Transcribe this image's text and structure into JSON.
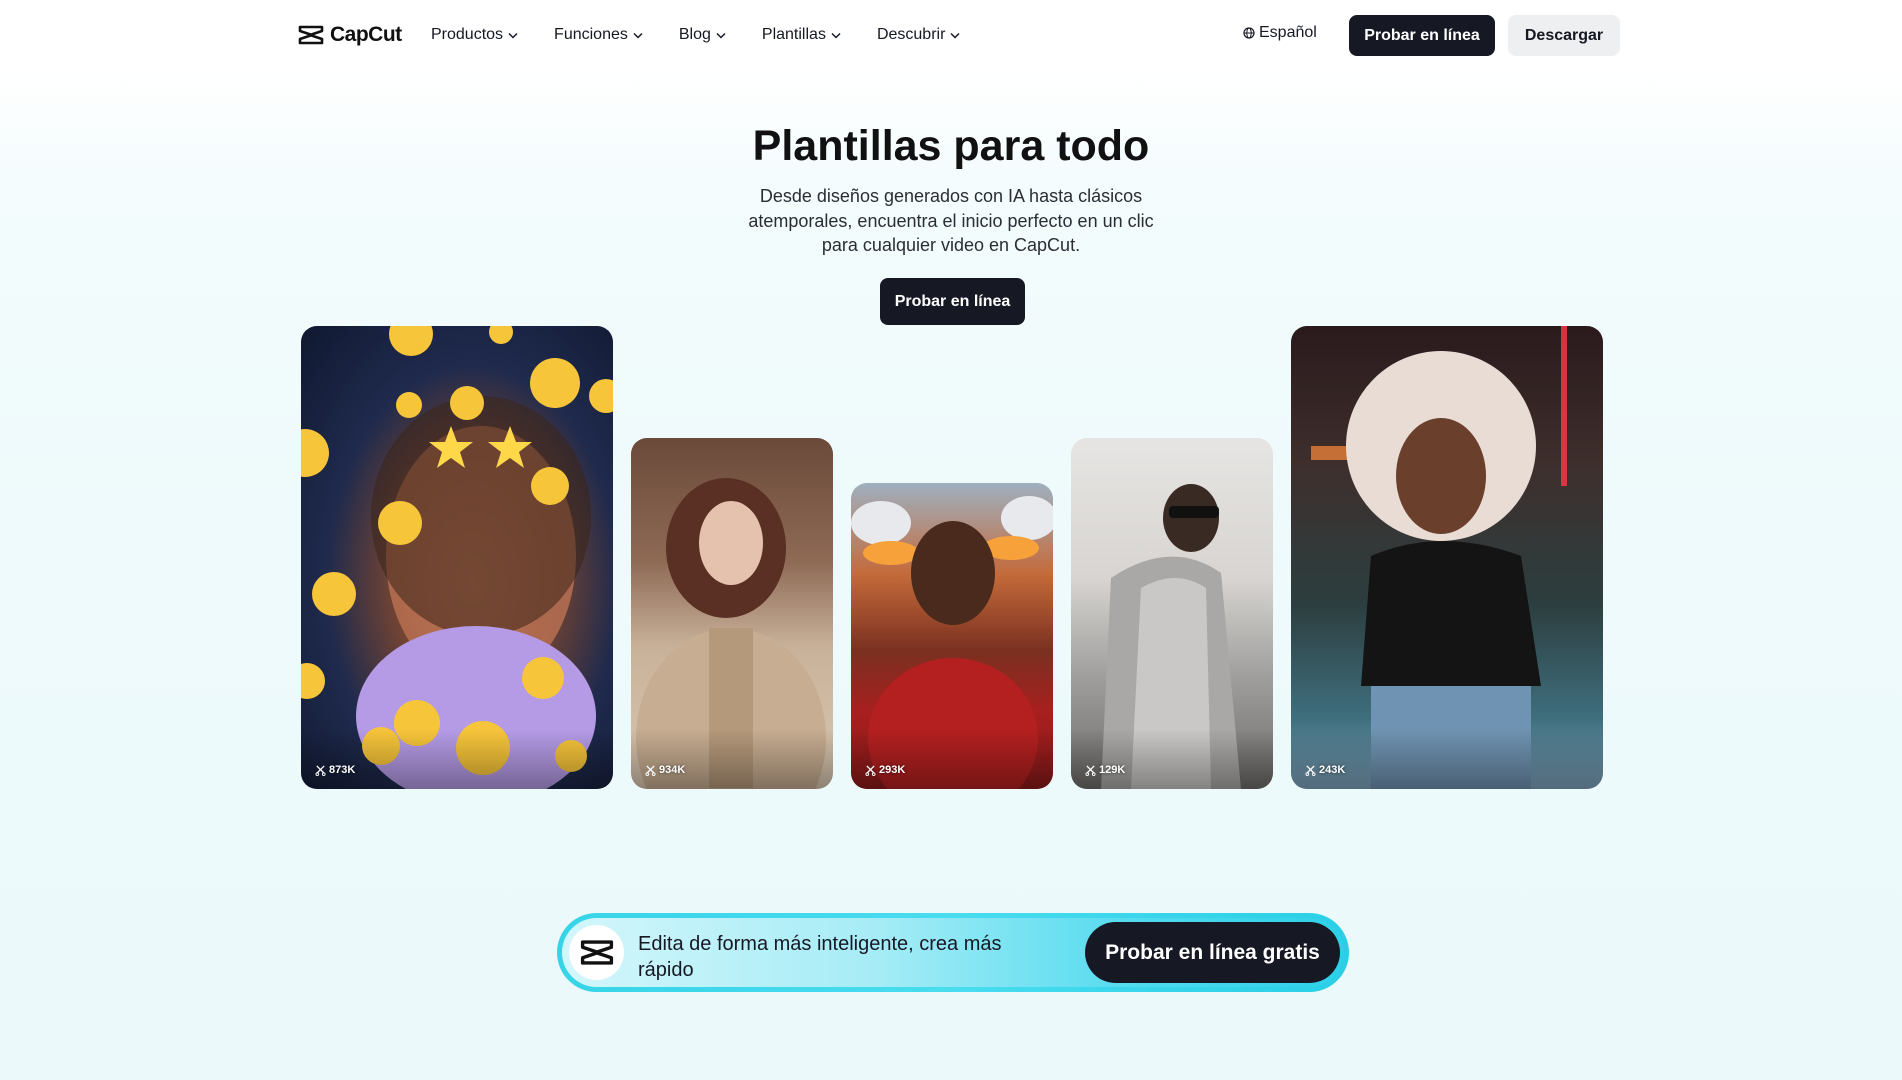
{
  "nav": {
    "brand": "CapCut",
    "items": [
      {
        "label": "Productos"
      },
      {
        "label": "Funciones"
      },
      {
        "label": "Blog"
      },
      {
        "label": "Plantillas"
      },
      {
        "label": "Descubrir"
      }
    ],
    "language": "Español",
    "try_online": "Probar en línea",
    "download": "Descargar"
  },
  "hero": {
    "title": "Plantillas para todo",
    "subtitle": "Desde diseños generados con IA hasta clásicos atemporales, encuentra el inicio perfecto en un clic para cualquier video en CapCut.",
    "cta": "Probar en línea"
  },
  "templates": [
    {
      "uses": "873K"
    },
    {
      "uses": "934K"
    },
    {
      "uses": "293K"
    },
    {
      "uses": "129K"
    },
    {
      "uses": "243K"
    }
  ],
  "banner": {
    "text": "Edita de forma más inteligente, crea más rápido",
    "button": "Probar en línea gratis"
  },
  "colors": {
    "primary_dark": "#161823",
    "banner_cyan": "#37d4e8"
  }
}
